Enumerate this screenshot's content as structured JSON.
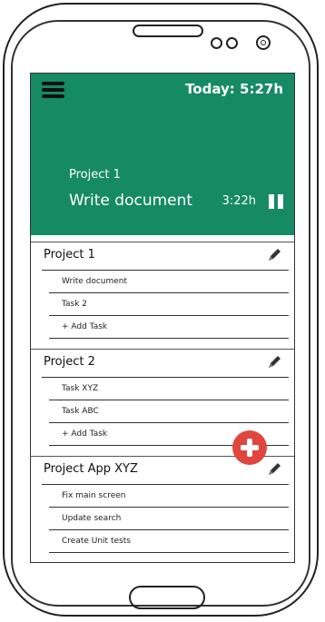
{
  "header": {
    "today_label": "Today: 5:27h",
    "current_project": "Project 1",
    "current_task": "Write document",
    "elapsed": "3:22h",
    "accent_color": "#168a63"
  },
  "projects": [
    {
      "title": "Project 1",
      "tasks": [
        "Write document",
        "Task 2",
        "+ Add Task"
      ]
    },
    {
      "title": "Project 2",
      "tasks": [
        "Task XYZ",
        "Task ABC",
        "+ Add Task"
      ]
    },
    {
      "title": "Project App XYZ",
      "tasks": [
        "Fix main screen",
        "Update search",
        "Create Unit tests"
      ]
    }
  ],
  "icons": {
    "menu": "menu-icon",
    "pause": "pause-icon",
    "edit": "pencil-icon",
    "add": "plus-icon"
  },
  "fab_color": "#e0453e"
}
